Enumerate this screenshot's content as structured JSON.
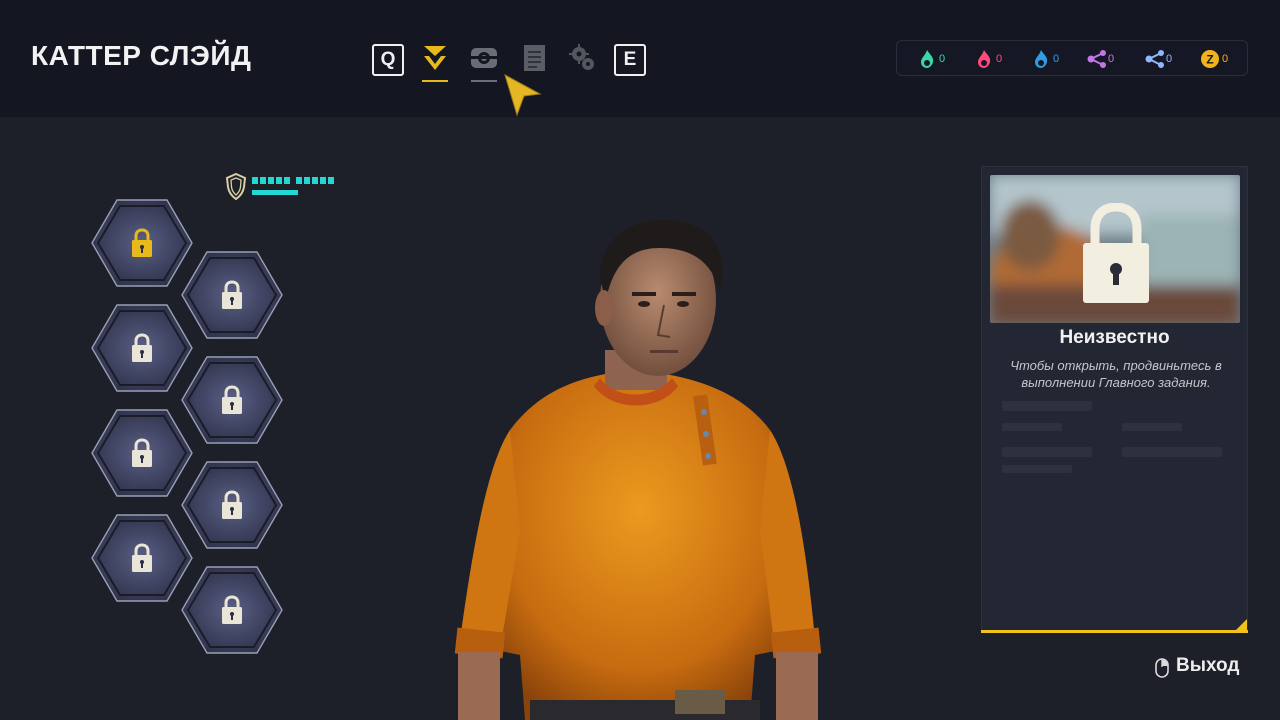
{
  "header": {
    "character_name": "КАТТЕР СЛЭЙД",
    "key_left": "Q",
    "key_right": "E",
    "tabs": [
      {
        "icon": "chevron-rank-icon",
        "active": true
      },
      {
        "icon": "gamepad-icon",
        "active": false
      },
      {
        "icon": "document-icon",
        "active": false
      },
      {
        "icon": "gears-icon",
        "active": false
      }
    ]
  },
  "resources": [
    {
      "icon": "green-flame-icon",
      "value": "0",
      "color": "#3ed6a4"
    },
    {
      "icon": "red-flame-icon",
      "value": "0",
      "color": "#ff4a7d"
    },
    {
      "icon": "blue-flame-icon",
      "value": "0",
      "color": "#2f9de6"
    },
    {
      "icon": "purple-nodes-icon",
      "value": "0",
      "color": "#c277e8"
    },
    {
      "icon": "blue-nodes-icon",
      "value": "0",
      "color": "#8fb8ff"
    },
    {
      "icon": "coin-icon",
      "value": "0",
      "color": "#f2b21b"
    }
  ],
  "armor": {
    "level": 0.5
  },
  "skills": [
    {
      "state": "selected-locked"
    },
    {
      "state": "locked"
    },
    {
      "state": "locked"
    },
    {
      "state": "locked"
    },
    {
      "state": "locked"
    },
    {
      "state": "locked"
    },
    {
      "state": "locked"
    },
    {
      "state": "locked"
    }
  ],
  "info_card": {
    "title": "Неизвестно",
    "description": "Чтобы открыть, продвиньтесь в выполнении Главного задания."
  },
  "footer": {
    "exit_label": "Выход"
  },
  "colors": {
    "accent": "#f0c21b",
    "armor": "#23d7d2"
  }
}
